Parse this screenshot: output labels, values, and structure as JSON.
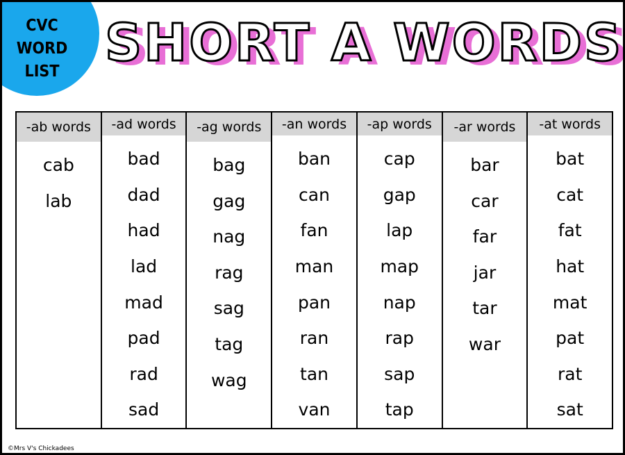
{
  "badge": {
    "lines": [
      "CVC",
      "WORD",
      "LIST"
    ]
  },
  "title": "SHORT A WORDS",
  "columns": [
    {
      "header": "-ab words",
      "words": [
        "cab",
        "lab"
      ]
    },
    {
      "header": "-ad words",
      "words": [
        "bad",
        "dad",
        "had",
        "lad",
        "mad",
        "pad",
        "rad",
        "sad"
      ]
    },
    {
      "header": "-ag words",
      "words": [
        "bag",
        "gag",
        "nag",
        "rag",
        "sag",
        "tag",
        "wag"
      ]
    },
    {
      "header": "-an words",
      "words": [
        "ban",
        "can",
        "fan",
        "man",
        "pan",
        "ran",
        "tan",
        "van"
      ]
    },
    {
      "header": "-ap words",
      "words": [
        "cap",
        "gap",
        "lap",
        "map",
        "nap",
        "rap",
        "sap",
        "tap"
      ]
    },
    {
      "header": "-ar words",
      "words": [
        "bar",
        "car",
        "far",
        "jar",
        "tar",
        "war"
      ]
    },
    {
      "header": "-at words",
      "words": [
        "bat",
        "cat",
        "fat",
        "hat",
        "mat",
        "pat",
        "rat",
        "sat"
      ]
    }
  ],
  "copyright": "©Mrs V's Chickadees",
  "colors": {
    "badge": "#1aa7ec",
    "title_shadow": "#e86fd6",
    "header_bg": "#d6d6d6"
  }
}
